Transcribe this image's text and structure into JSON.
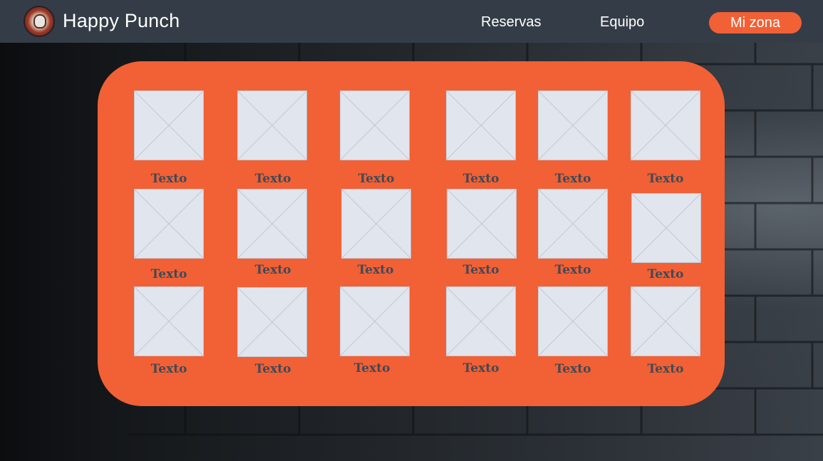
{
  "header": {
    "brand": "Happy Punch",
    "nav": {
      "reservas": "Reservas",
      "equipo": "Equipo",
      "mi_zona": "Mi zona"
    }
  },
  "colors": {
    "header_bg": "#343d47",
    "accent": "#f26035",
    "tile_bg": "#e1e5ee",
    "tile_line": "#c3c9d3",
    "caption": "#3f4a57"
  },
  "grid": {
    "items": [
      {
        "label": "Texto"
      },
      {
        "label": "Texto"
      },
      {
        "label": "Texto"
      },
      {
        "label": "Texto"
      },
      {
        "label": "Texto"
      },
      {
        "label": "Texto"
      },
      {
        "label": "Texto"
      },
      {
        "label": "Texto"
      },
      {
        "label": "Texto"
      },
      {
        "label": "Texto"
      },
      {
        "label": "Texto"
      },
      {
        "label": "Texto"
      },
      {
        "label": "Texto"
      },
      {
        "label": "Texto"
      },
      {
        "label": "Texto"
      },
      {
        "label": "Texto"
      },
      {
        "label": "Texto"
      },
      {
        "label": "Texto"
      }
    ]
  }
}
